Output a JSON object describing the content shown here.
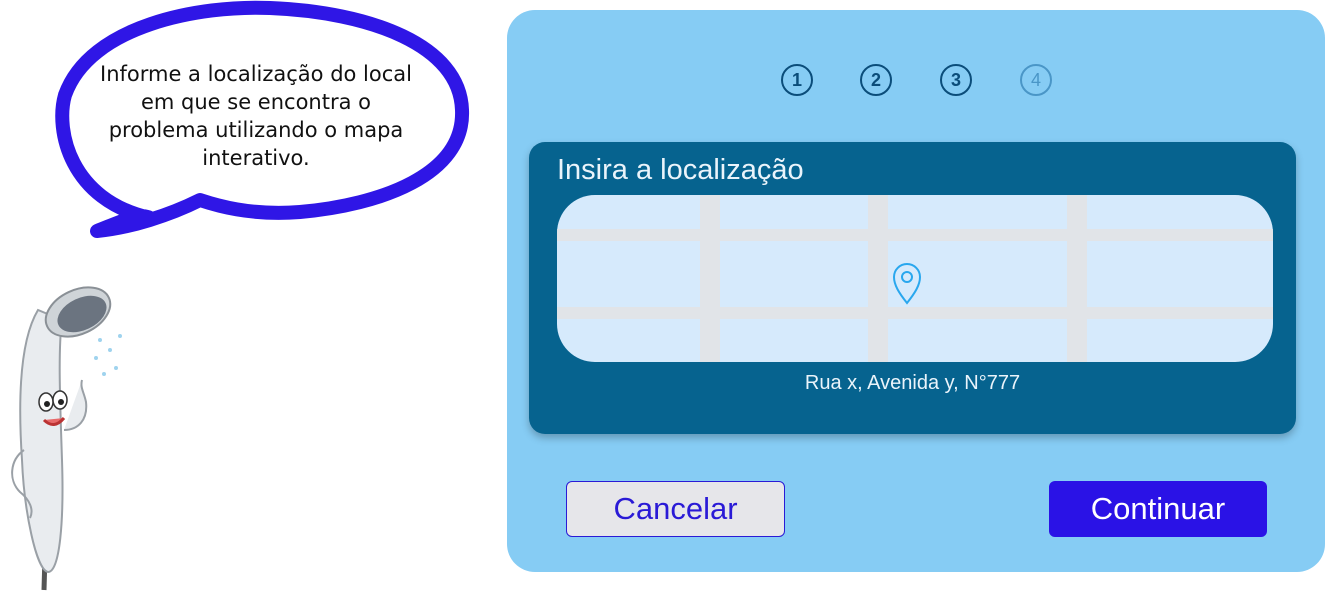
{
  "assistant": {
    "message": "Informe a localização do local em que se encontra o problema utilizando o mapa interativo.",
    "mascot_icon": "shower-head-mascot",
    "bubble_outline_color": "#2f16e6"
  },
  "wizard": {
    "steps": [
      {
        "label": "1",
        "active": true
      },
      {
        "label": "2",
        "active": true
      },
      {
        "label": "3",
        "active": true
      },
      {
        "label": "4",
        "active": false
      }
    ],
    "location_card": {
      "title": "Insira a localização",
      "address": "Rua x, Avenida y, N°777",
      "pin_icon": "map-pin-icon"
    },
    "buttons": {
      "cancel_label": "Cancelar",
      "continue_label": "Continuar"
    }
  },
  "colors": {
    "panel": "#86ccf4",
    "card": "#06638f",
    "map": "#d6eafc",
    "accent": "#2a12e6"
  }
}
